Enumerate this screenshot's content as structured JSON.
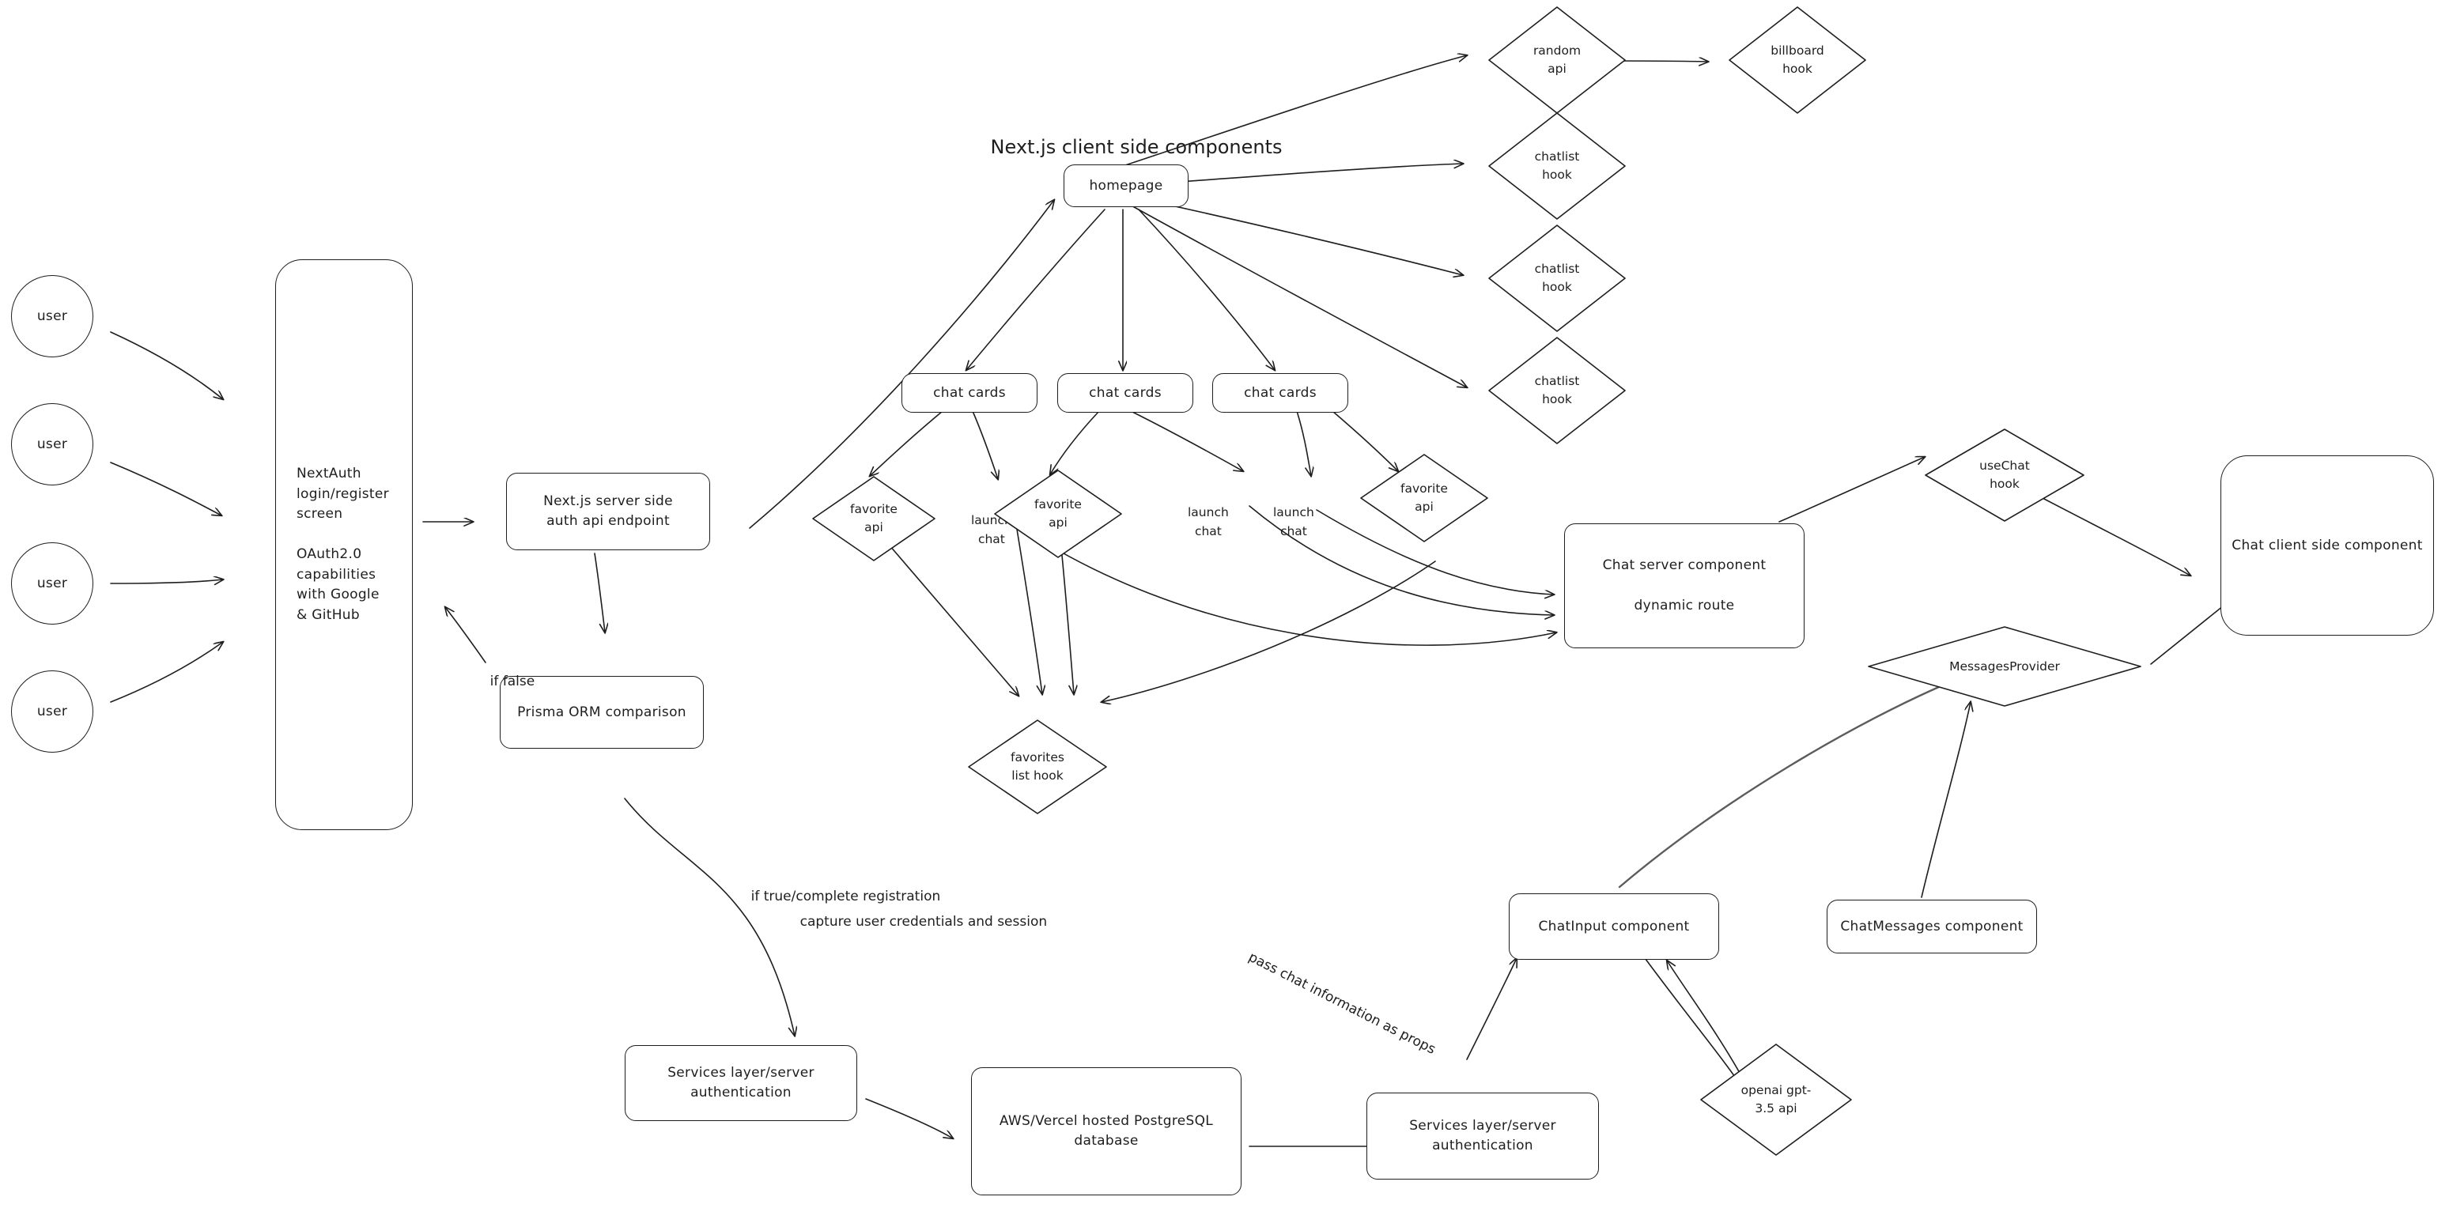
{
  "diagram": {
    "title_label": "Next.js client side components",
    "background": "#ffffff",
    "stroke": "#1e1e1e",
    "accent_gray": "#868686"
  },
  "users": [
    {
      "label": "user"
    },
    {
      "label": "user"
    },
    {
      "label": "user"
    },
    {
      "label": "user"
    }
  ],
  "nodes": {
    "nextauth_screen": "NextAuth\nlogin/register\nscreen\n\nOAuth2.0\ncapabilities\nwith Google\n& GitHub",
    "auth_endpoint": "Next.js server side\nauth api endpoint",
    "prisma": "Prisma ORM comparison",
    "homepage": "homepage",
    "random_api": "random\napi",
    "billboard_hook": "billboard\nhook",
    "chatlist_hook_1": "chatlist\nhook",
    "chatlist_hook_2": "chatlist\nhook",
    "chatlist_hook_3": "chatlist\nhook",
    "chat_cards_1": "chat cards",
    "chat_cards_2": "chat cards",
    "chat_cards_3": "chat cards",
    "favorite_api_1": "favorite\napi",
    "favorite_api_2": "favorite\napi",
    "favorite_api_3": "favorite\napi",
    "launch_chat_1": "launch\nchat",
    "launch_chat_2": "launch\nchat",
    "launch_chat_3": "launch\nchat",
    "favorites_list_hook": "favorites\nlist hook",
    "chat_server_component": "Chat server component\n\ndynamic route",
    "usechat_hook": "useChat\nhook",
    "messages_provider": "MessagesProvider",
    "chat_client_component": "Chat client side component",
    "services_layer_left": "Services layer/server\nauthentication",
    "postgres_db": "AWS/Vercel hosted PostgreSQL\ndatabase",
    "services_layer_right": "Services layer/server\nauthentication",
    "chat_input": "ChatInput component",
    "chat_messages": "ChatMessages component",
    "openai_api": "openai gpt-\n3.5 api"
  },
  "edge_labels": {
    "if_false": "if false",
    "if_true_registration": "if true/complete registration",
    "capture_credentials": "capture user credentials and session",
    "pass_chat_props": "pass chat information as props"
  }
}
